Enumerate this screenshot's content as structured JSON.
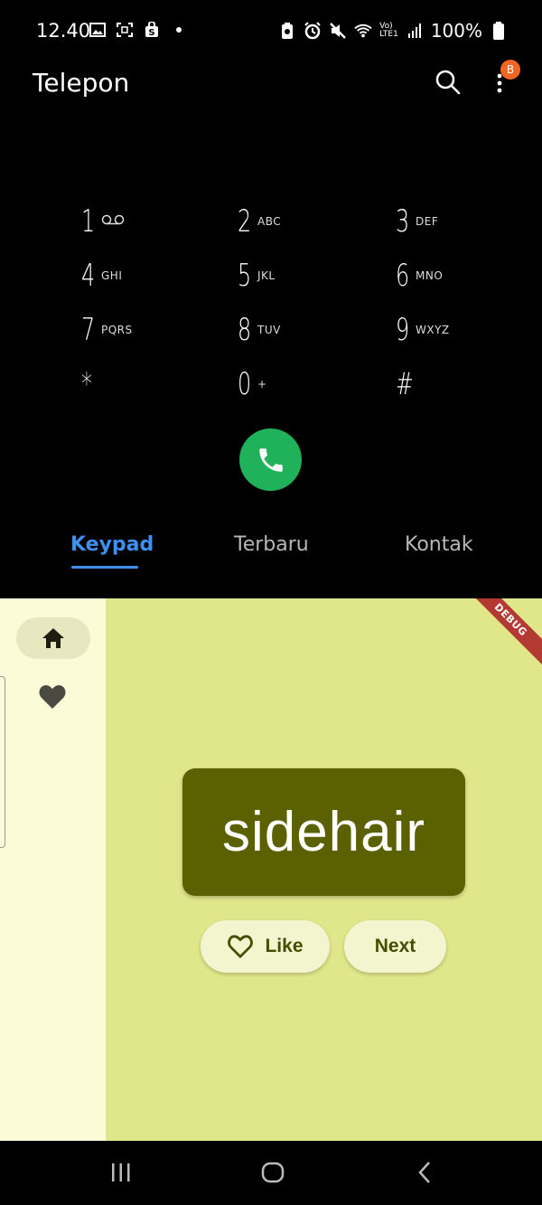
{
  "status_bar": {
    "time": "12.40",
    "battery": "100%",
    "lte_label_top": "Vo)",
    "lte_label_bottom": "LTE1"
  },
  "app_bar": {
    "title": "Telepon",
    "badge": "B",
    "icons": [
      "search-icon",
      "more-vert-icon"
    ]
  },
  "keypad": {
    "keys": [
      {
        "digit": "1",
        "letters": "",
        "icon": "voicemail-icon"
      },
      {
        "digit": "2",
        "letters": "ABC"
      },
      {
        "digit": "3",
        "letters": "DEF"
      },
      {
        "digit": "4",
        "letters": "GHI"
      },
      {
        "digit": "5",
        "letters": "JKL"
      },
      {
        "digit": "6",
        "letters": "MNO"
      },
      {
        "digit": "7",
        "letters": "PQRS"
      },
      {
        "digit": "8",
        "letters": "TUV"
      },
      {
        "digit": "9",
        "letters": "WXYZ"
      },
      {
        "digit": "*",
        "letters": ""
      },
      {
        "digit": "0",
        "letters": "+"
      },
      {
        "digit": "#",
        "letters": ""
      }
    ]
  },
  "tabs": [
    {
      "label": "Keypad",
      "active": true
    },
    {
      "label": "Terbaru",
      "active": false
    },
    {
      "label": "Kontak",
      "active": false
    }
  ],
  "flutter_app": {
    "word": "sidehair",
    "like_label": "Like",
    "next_label": "Next",
    "debug_label": "DEBUG",
    "colors": {
      "background": "#e0e68a",
      "rail": "#fbfbd8",
      "card": "#5b6100",
      "pill": "#f3f5cf",
      "accent_text": "#464c00"
    }
  },
  "colors": {
    "call_button": "#1fb25a",
    "active_tab": "#3d8ff0"
  }
}
